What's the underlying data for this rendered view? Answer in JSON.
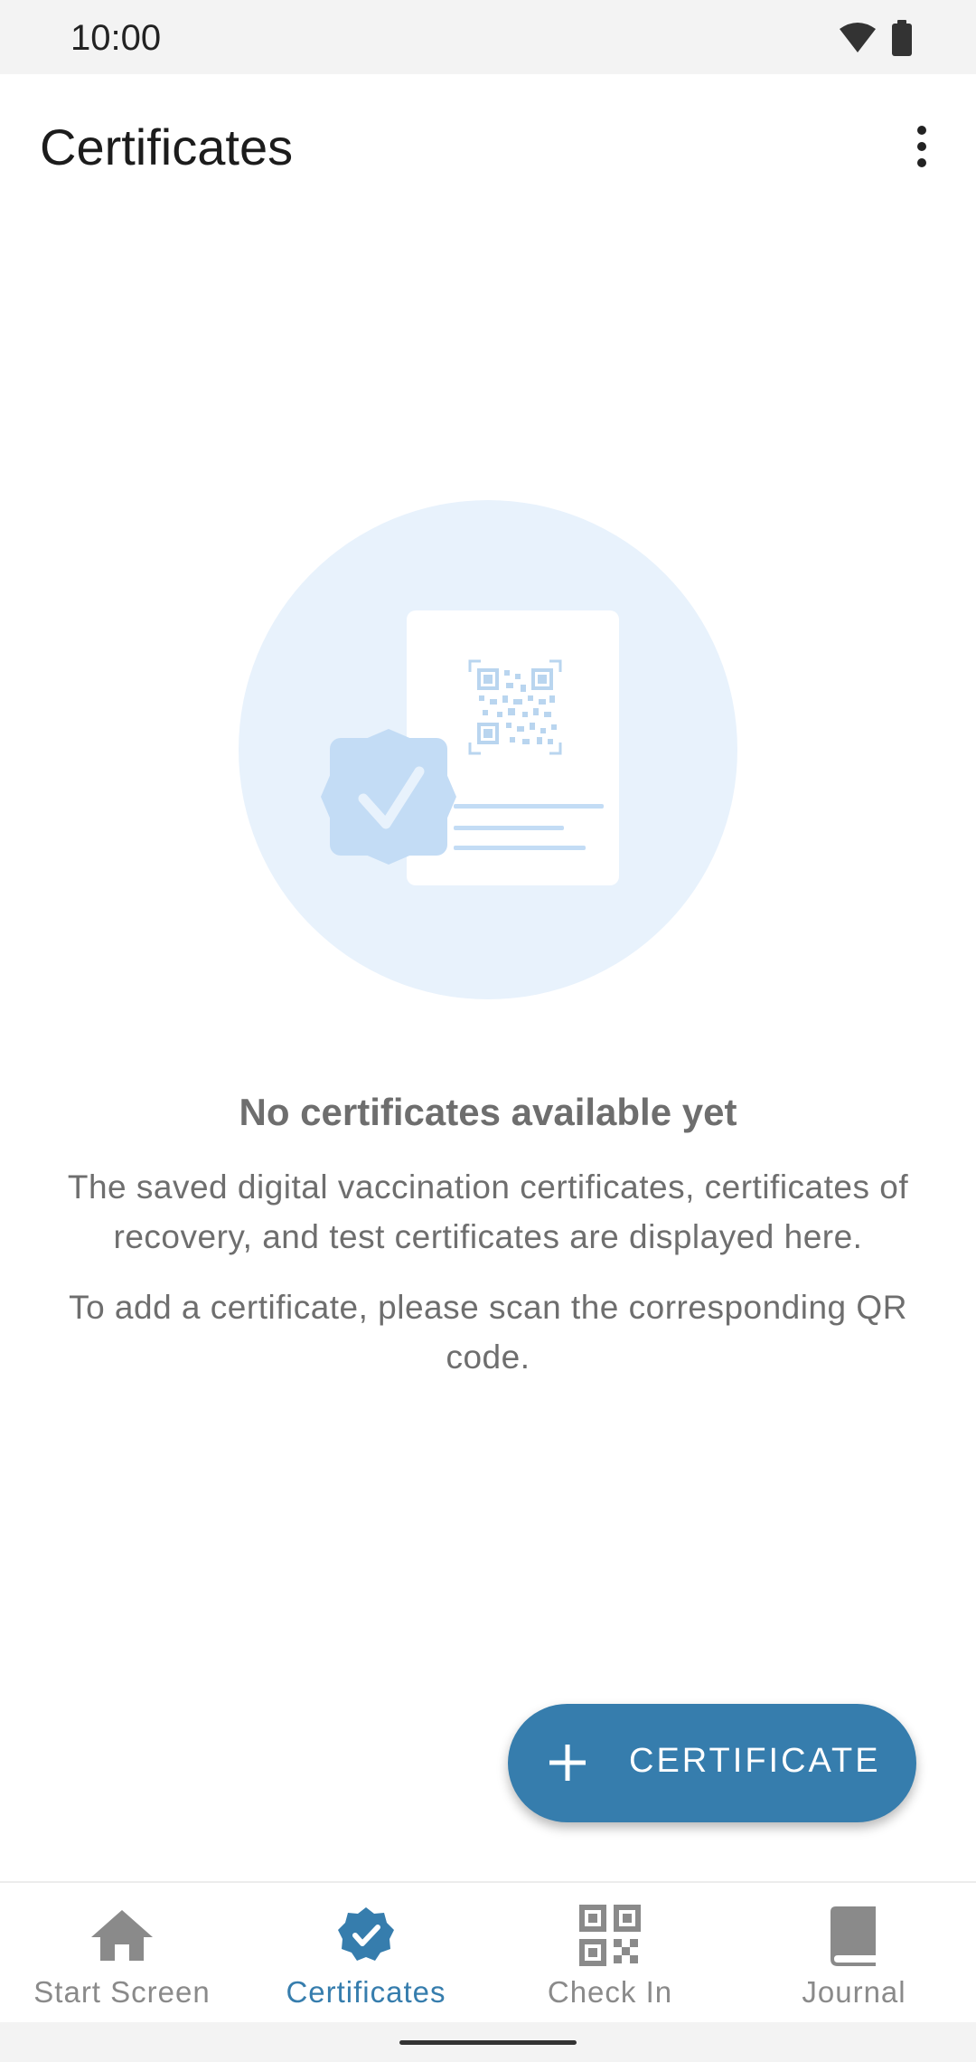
{
  "status_bar": {
    "time": "10:00",
    "icons": [
      "wifi-icon",
      "battery-icon"
    ]
  },
  "app_bar": {
    "title": "Certificates",
    "menu_icon": "more-vert-icon"
  },
  "empty_state": {
    "illustration": "certificate-qr-illustration",
    "title": "No certificates available yet",
    "description": "The saved digital vaccination certificates, certificates of recovery, and test certificates are displayed here.",
    "hint": "To add a certificate, please scan the corresponding QR code."
  },
  "fab": {
    "icon": "plus-icon",
    "label": "CERTIFICATE"
  },
  "bottom_nav": {
    "items": [
      {
        "label": "Start Screen",
        "icon": "home-icon",
        "active": false
      },
      {
        "label": "Certificates",
        "icon": "verified-badge-icon",
        "active": true
      },
      {
        "label": "Check In",
        "icon": "qr-code-icon",
        "active": false
      },
      {
        "label": "Journal",
        "icon": "book-icon",
        "active": false
      }
    ]
  },
  "colors": {
    "accent": "#367dad",
    "inactive": "#8a8a8a",
    "illustration_bg": "#e8f2fc",
    "illustration_badge": "#c3dcf5"
  }
}
